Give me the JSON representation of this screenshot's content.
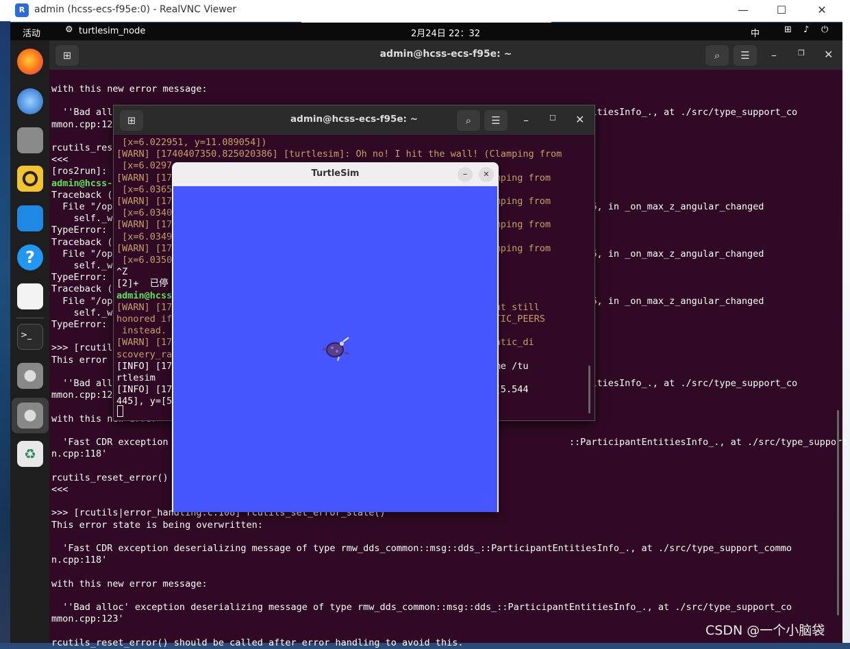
{
  "vnc": {
    "title": "admin (hcss-ecs-f95e:0) - RealVNC Viewer",
    "min": "—",
    "max": "☐",
    "close": "✕"
  },
  "gnome": {
    "activities": "活动",
    "app": "turtlesim_node",
    "clock": "2月24日 22：32",
    "ime": "中"
  },
  "dock": [
    {
      "name": "firefox",
      "color": "#ff7139"
    },
    {
      "name": "thunderbird",
      "color": "#2a7de1"
    },
    {
      "name": "files",
      "color": "#7a7a7a"
    },
    {
      "name": "rhythmbox",
      "color": "#f4c430"
    },
    {
      "name": "writer",
      "color": "#1e88e5"
    },
    {
      "name": "help",
      "color": "#2196f3"
    },
    {
      "name": "text-editor",
      "color": "#f5f5f5"
    },
    {
      "name": "terminal",
      "color": "#2b2b2b"
    },
    {
      "name": "settings",
      "color": "#7a7a7a"
    },
    {
      "name": "settings-active",
      "color": "#7a7a7a"
    },
    {
      "name": "trash",
      "color": "#e0e0e0"
    }
  ],
  "terminal_main": {
    "title": "admin@hcss-ecs-f95e: ~",
    "lines": [
      "with this new error message:",
      "",
      "  ''Bad all                                                                                 ::EntitiesInfo_., at ./src/type_support_co",
      "mmon.cpp:12",
      "",
      "rcutils_res",
      "<<<",
      "[ros2run]:",
      "admin@hcss-",
      "Traceback (",
      "  File \"/op                                                                               line 236, in _on_max_z_angular_changed",
      "    self._w",
      "TypeError:",
      "Traceback (",
      "  File \"/op                                                                               line 236, in _on_max_z_angular_changed",
      "    self._w",
      "TypeError:",
      "Traceback (",
      "  File \"/op                                                                               line 236, in _on_max_z_angular_changed",
      "    self._w",
      "TypeError:",
      "",
      ">>> [rcutil",
      "This error",
      "",
      "  ''Bad all                                                                                 ::EntitiesInfo_., at ./src/type_support_co",
      "mmon.cpp:12",
      "",
      "with this new error",
      "",
      "  'Fast CDR exception                                                                        ::ParticipantEntitiesInfo_., at ./src/type_support_commo",
      "n.cpp:118'",
      "",
      "rcutils_reset_error()",
      "<<<",
      "",
      ">>> [rcutils|error_handling.c:108] rcutils_set_error_state()",
      "This error state is being overwritten:",
      "",
      "  'Fast CDR exception deserializing message of type rmw_dds_common::msg::dds_::ParticipantEntitiesInfo_., at ./src/type_support_commo",
      "n.cpp:118'",
      "",
      "with this new error message:",
      "",
      "  ''Bad alloc' exception deserializing message of type rmw_dds_common::msg::dds_::ParticipantEntitiesInfo_., at ./src/type_support_co",
      "mmon.cpp:123'",
      "",
      "rcutils_reset_error() should be called after error handling to avoid this."
    ]
  },
  "terminal_two": {
    "title": "admin@hcss-ecs-f95e: ~",
    "lines": [
      " [x=6.022951, y=11.089054])",
      "[WARN] [1740407350.825020386] [turtlesim]: Oh no! I hit the wall! (Clamping from",
      " [x=6.0297",
      "[WARN] [17                                                      (Clamping from",
      " [x=6.0365",
      "[WARN] [17                                                      (Clamping from",
      " [x=6.0340",
      "[WARN] [17                                                      (Clamping from",
      " [x=6.0349",
      "[WARN] [17                                                      (Clamping from",
      " [x=6.0350",
      "^Z",
      "[2]+  已停",
      "admin@hcss",
      "[WARN] [17                                                    ated but still",
      "honored if                                                    DS_STATIC_PEERS",
      " instead.",
      "[WARN] [17                                                  , 'automatic_di",
      "scovery_ra",
      "[INFO] [17                                                 h node name /tu",
      "rtlesim",
      "[INFO] [17                                                 e1] at x=[5.544",
      "445], y=[5"
    ]
  },
  "turtlesim": {
    "title": "TurtleSim",
    "min": "–",
    "close": "✕",
    "background": "#4556ff"
  },
  "watermark": "CSDN @一个小脑袋"
}
